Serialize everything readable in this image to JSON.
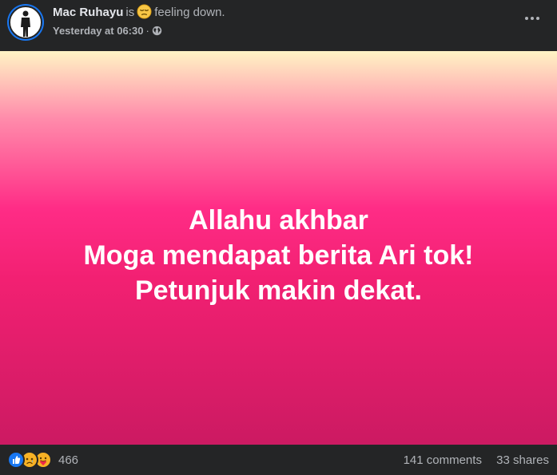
{
  "post": {
    "author": "Mac Ruhayu",
    "is_word": "is",
    "feeling": "feeling down.",
    "timestamp": "Yesterday at 06:30",
    "separator": "·",
    "audience_icon": "globe-icon",
    "menu_icon": "more-options-icon"
  },
  "card": {
    "lines": [
      "Allahu akhbar",
      "Moga mendapat berita Ari tok!",
      "Petunjuk makin dekat."
    ]
  },
  "footer": {
    "reaction_icons": [
      "like-reaction-icon",
      "sad-reaction-icon",
      "care-reaction-icon"
    ],
    "reaction_count": "466",
    "comments": "141 comments",
    "shares": "33 shares"
  },
  "colors": {
    "background": "#242526",
    "primary_text": "#e4e6eb",
    "secondary_text": "#b0b3b8",
    "accent": "#1877f2",
    "card_top": "#fff4c4",
    "card_mid": "#ff2c86",
    "card_bottom": "#cc1a62"
  }
}
